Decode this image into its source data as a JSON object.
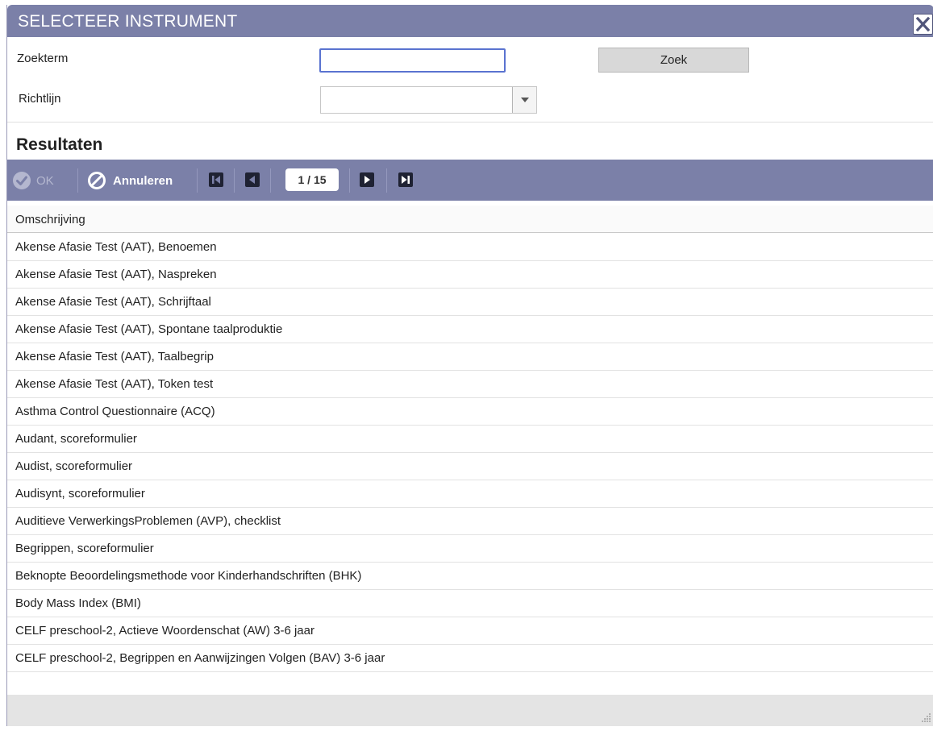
{
  "dialog": {
    "title": "SELECTEER INSTRUMENT"
  },
  "form": {
    "search_label": "Zoekterm",
    "search_value": "",
    "search_button": "Zoek",
    "guideline_label": "Richtlijn",
    "guideline_value": ""
  },
  "results": {
    "title": "Resultaten",
    "toolbar": {
      "ok_label": "OK",
      "cancel_label": "Annuleren",
      "page_indicator": "1 / 15"
    },
    "column_header": "Omschrijving",
    "rows": [
      "Akense Afasie Test (AAT), Benoemen",
      "Akense Afasie Test (AAT), Naspreken",
      "Akense Afasie Test (AAT), Schrijftaal",
      "Akense Afasie Test (AAT), Spontane taalproduktie",
      "Akense Afasie Test (AAT), Taalbegrip",
      "Akense Afasie Test (AAT), Token test",
      "Asthma Control Questionnaire (ACQ)",
      "Audant, scoreformulier",
      "Audist, scoreformulier",
      "Audisynt, scoreformulier",
      "Auditieve VerwerkingsProblemen (AVP), checklist",
      "Begrippen, scoreformulier",
      "Beknopte Beoordelingsmethode voor Kinderhandschriften (BHK)",
      "Body Mass Index (BMI)",
      "CELF preschool-2, Actieve Woordenschat (AW) 3-6 jaar",
      "CELF preschool-2, Begrippen en Aanwijzingen Volgen (BAV) 3-6 jaar"
    ]
  },
  "colors": {
    "header_bar": "#7b80a8",
    "input_focus": "#5a73d0",
    "footer": "#e4e4e4"
  },
  "icons": {
    "close": "close-icon",
    "ok": "check-circle-icon",
    "cancel": "cancel-circle-icon",
    "first": "first-page-icon",
    "prev": "previous-page-icon",
    "next": "next-page-icon",
    "last": "last-page-icon"
  }
}
